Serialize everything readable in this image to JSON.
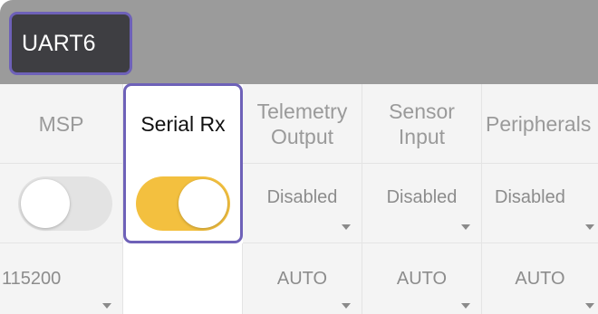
{
  "port": {
    "name": "UART6"
  },
  "columns": [
    {
      "id": "msp",
      "label": "MSP"
    },
    {
      "id": "serial-rx",
      "label": "Serial Rx"
    },
    {
      "id": "telemetry-output",
      "label": "Telemetry Output"
    },
    {
      "id": "sensor-input",
      "label": "Sensor Input"
    },
    {
      "id": "peripherals",
      "label": "Peripherals"
    }
  ],
  "toggles": {
    "msp": {
      "state": "off"
    },
    "serial_rx": {
      "state": "on"
    }
  },
  "selects": {
    "telemetry": "Disabled",
    "sensor": "Disabled",
    "peripherals": "Disabled"
  },
  "bauds": {
    "msp": "115200",
    "telemetry": "AUTO",
    "sensor": "AUTO",
    "peripherals": "AUTO"
  },
  "colors": {
    "header_bg": "#9b9b9b",
    "chip_bg": "#3e3e42",
    "highlight": "#6e61b8",
    "toggle_on": "#f3c03f",
    "toggle_off": "#e3e3e3"
  }
}
